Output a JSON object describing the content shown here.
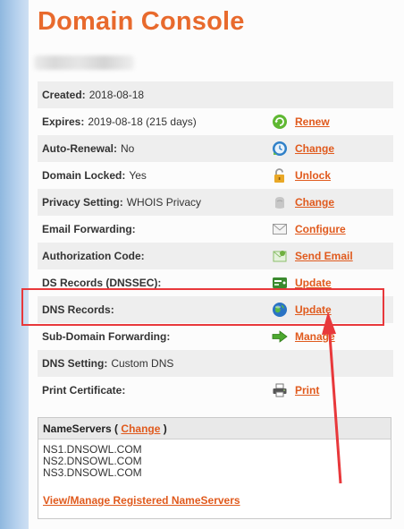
{
  "page": {
    "title": "Domain Console"
  },
  "details": [
    {
      "label": "Created:",
      "value": "2018-08-18",
      "action": null,
      "icon": null
    },
    {
      "label": "Expires:",
      "value": "2019-08-18 (215 days)",
      "action": "Renew",
      "icon": "renew-icon"
    },
    {
      "label": "Auto-Renewal:",
      "value": "No",
      "action": "Change",
      "icon": "clock-icon"
    },
    {
      "label": "Domain Locked:",
      "value": "Yes",
      "action": "Unlock",
      "icon": "lock-icon"
    },
    {
      "label": "Privacy Setting:",
      "value": "WHOIS Privacy",
      "action": "Change",
      "icon": "privacy-icon"
    },
    {
      "label": "Email Forwarding:",
      "value": "",
      "action": "Configure",
      "icon": "envelope-icon"
    },
    {
      "label": "Authorization Code:",
      "value": "",
      "action": "Send Email",
      "icon": "mail-code-icon"
    },
    {
      "label": "DS Records (DNSSEC):",
      "value": "",
      "action": "Update",
      "icon": "ds-records-icon"
    },
    {
      "label": "DNS Records:",
      "value": "",
      "action": "Update",
      "icon": "globe-icon"
    },
    {
      "label": "Sub-Domain Forwarding:",
      "value": "",
      "action": "Manage",
      "icon": "arrow-right-icon"
    },
    {
      "label": "DNS Setting:",
      "value": "Custom DNS",
      "action": null,
      "icon": null
    },
    {
      "label": "Print Certificate:",
      "value": "",
      "action": "Print",
      "icon": "printer-icon"
    }
  ],
  "nameservers": {
    "heading": "NameServers (",
    "change_label": "Change",
    "heading_close": ")",
    "list": [
      "NS1.DNSOWL.COM",
      "NS2.DNSOWL.COM",
      "NS3.DNSOWL.COM"
    ],
    "manage_link": "View/Manage Registered NameServers"
  },
  "colors": {
    "accent": "#e86a2d",
    "link": "#e05a1d",
    "highlight": "#e8383b",
    "row_shade": "#eeeeee"
  }
}
